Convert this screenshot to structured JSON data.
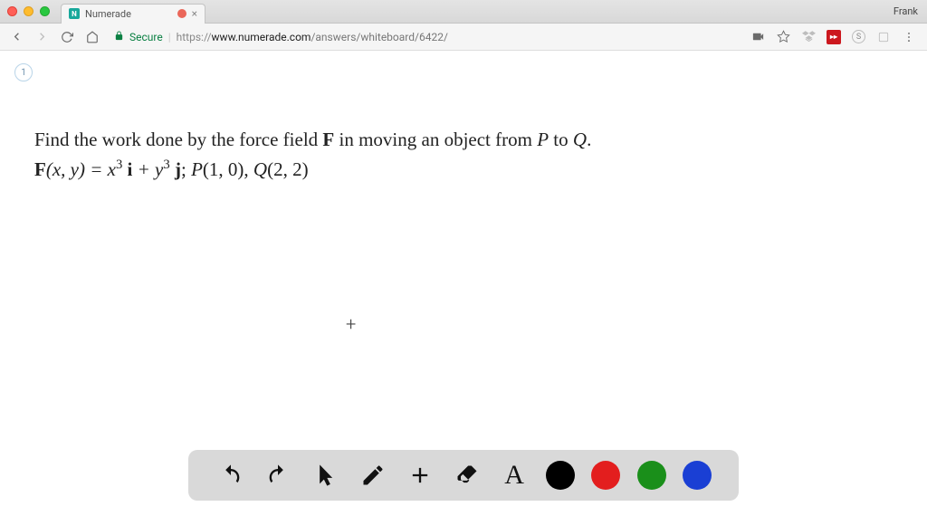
{
  "browser": {
    "user_name": "Frank",
    "tab": {
      "title": "Numerade",
      "favicon_letter": "N"
    },
    "url": {
      "secure_label": "Secure",
      "scheme": "https://",
      "host": "www.numerade.com",
      "path": "/answers/whiteboard/6422/"
    }
  },
  "page": {
    "slide_number": "1",
    "question_line1_prefix": "Find the work done by the force field ",
    "question_line1_F": "F",
    "question_line1_mid": " in moving an object from ",
    "question_line1_P": "P",
    "question_line1_to": " to ",
    "question_line1_Q": "Q",
    "question_line1_period": ".",
    "eq": {
      "F": "F",
      "args": "(x, y) = x",
      "exp1": "3",
      "i_space": " ",
      "i": "i",
      "plus": " + y",
      "exp2": "3",
      "j_space": " ",
      "j": "j",
      "sep": "; ",
      "P": "P",
      "p_coords": "(1, 0), ",
      "Q": "Q",
      "q_coords": "(2, 2)"
    }
  },
  "toolbar": {
    "undo": "undo",
    "redo": "redo",
    "pointer": "pointer",
    "pencil": "pencil",
    "add_shape": "add-shape",
    "eraser": "eraser",
    "text": "text",
    "text_glyph": "A",
    "colors": {
      "black": "#000000",
      "red": "#e31e1e",
      "green": "#1a8f1a",
      "blue": "#1a3fd4"
    }
  }
}
